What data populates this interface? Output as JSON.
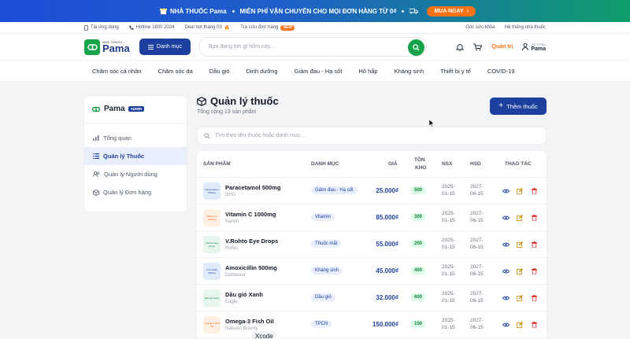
{
  "promo": {
    "brand": "NHÀ THUỐC Pama",
    "message": "MIỄN PHÍ VẬN CHUYỂN CHO MỌI ĐƠN HÀNG TỪ 0₫",
    "cta": "MUA NGAY",
    "colors": {
      "start": "#1d4ed8",
      "end": "#0f9d6b",
      "cta": "#f97316"
    }
  },
  "topbar": {
    "app": "Tải ứng dụng",
    "hotline": "Hotline 1800 2024",
    "deal": "Deal hot tháng 03",
    "order_lookup": "Tra cứu đơn hàng",
    "new_badge": "NEW",
    "health_corner": "Góc sức khỏe",
    "store_system": "Hệ thống nhà thuốc"
  },
  "header": {
    "logo_small": "NHÀ THUỐC",
    "logo_big": "Pama",
    "category_button": "Danh mục",
    "search_placeholder": "Bạn đang tìm gì hôm nay...",
    "admin_link": "Quản trị",
    "greeting": "Xin Chào",
    "username": "Pama"
  },
  "categories": [
    "Chăm sóc cá nhân",
    "Chăm sóc da",
    "Dầu gió",
    "Dinh dưỡng",
    "Giảm đau - Hạ sốt",
    "Hô hấp",
    "Kháng sinh",
    "Thiết bị y tế",
    "COVID-19"
  ],
  "sidebar": {
    "brand": "Pama",
    "badge": "ADMIN",
    "items": [
      {
        "label": "Tổng quan",
        "icon": "chart-icon"
      },
      {
        "label": "Quản lý Thuốc",
        "icon": "list-icon"
      },
      {
        "label": "Quản lý Người dùng",
        "icon": "users-icon"
      },
      {
        "label": "Quản lý Đơn hàng",
        "icon": "box-icon"
      }
    ]
  },
  "main": {
    "title": "Quản lý thuốc",
    "subtitle": "Tổng cộng 13 sản phẩm",
    "add_button": "Thêm thuốc",
    "filter_placeholder": "Tìm theo tên thuốc hoặc danh mục...",
    "columns": {
      "product": "SẢN PHẨM",
      "category": "DANH MỤC",
      "price": "GIÁ",
      "stock1": "TỒN",
      "stock2": "KHO",
      "mfg": "NSX",
      "exp": "HSD",
      "actions": "THAO TÁC"
    }
  },
  "products": [
    {
      "name": "Paracetamol 500mg",
      "maker": "DHG",
      "category": "Giảm đau - Hạ sốt",
      "price": "25.000₫",
      "stock": "500",
      "mfg_a": "2025-",
      "mfg_b": "01-15",
      "exp_a": "2027-",
      "exp_b": "06-15",
      "thumb": "Paracetamol 500mg",
      "thumb_bg": "#e0ebfb",
      "thumb_fg": "#1d3f9e"
    },
    {
      "name": "Vitamin C 1000mg",
      "maker": "Sanofi",
      "category": "Vitamin",
      "price": "85.000₫",
      "stock": "300",
      "mfg_a": "2025-",
      "mfg_b": "01-15",
      "exp_a": "2027-",
      "exp_b": "06-15",
      "thumb": "Vitamin C 1000mg",
      "thumb_bg": "#fdf0e2",
      "thumb_fg": "#ea580c"
    },
    {
      "name": "V.Rohto Eye Drops",
      "maker": "Rohto",
      "category": "Thuốc mắt",
      "price": "55.000₫",
      "stock": "200",
      "mfg_a": "2025-",
      "mfg_b": "01-15",
      "exp_a": "2027-",
      "exp_b": "06-15",
      "thumb": "V.Rohto Eye Drops",
      "thumb_bg": "#e6f6ec",
      "thumb_fg": "#15803d"
    },
    {
      "name": "Amoxicillin 500mg",
      "maker": "Domesco",
      "category": "Kháng sinh",
      "price": "45.000₫",
      "stock": "400",
      "mfg_a": "2025-",
      "mfg_b": "01-15",
      "exp_a": "2027-",
      "exp_b": "06-15",
      "thumb": "Amoxicillin 500mg",
      "thumb_bg": "#e0ebfb",
      "thumb_fg": "#1d3f9e"
    },
    {
      "name": "Dầu gió Xanh",
      "maker": "Eagle",
      "category": "Dầu gió",
      "price": "32.000₫",
      "stock": "600",
      "mfg_a": "2025-",
      "mfg_b": "01-15",
      "exp_a": "2027-",
      "exp_b": "06-15",
      "thumb": "Dầu gió Xanh",
      "thumb_bg": "#e6f6ec",
      "thumb_fg": "#15803d"
    },
    {
      "name": "Omega-3 Fish Oil",
      "maker": "Natures Bounty",
      "category": "TPCN",
      "price": "150.000₫",
      "stock": "150",
      "mfg_a": "2025-",
      "mfg_b": "01-15",
      "exp_a": "2027-",
      "exp_b": "06-15",
      "thumb": "Omega-3 Fish Oil",
      "thumb_bg": "#fdf0e2",
      "thumb_fg": "#ea580c"
    }
  ],
  "tooltip": "Xcode",
  "colors": {
    "brand_blue": "#1d3f9e",
    "brand_green": "#16a34a",
    "accent_orange": "#f97316",
    "danger": "#dc2626",
    "edit": "#ca8a04"
  }
}
